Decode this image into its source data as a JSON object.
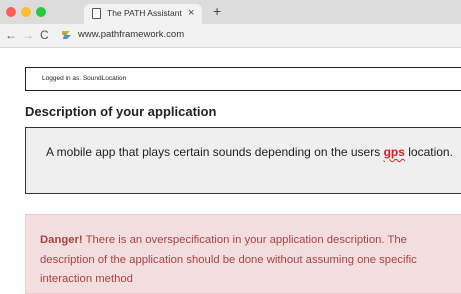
{
  "browser": {
    "tab_title": "The PATH Assistant",
    "tab_close": "×",
    "new_tab": "+",
    "back": "←",
    "forward": "→",
    "reload": "C",
    "url": "www.pathframework.com"
  },
  "page": {
    "login_status": "Logged in as: SoundLocation",
    "section_title": "Description of your application",
    "description": {
      "text_before": "A mobile app that plays certain sounds depending on the users ",
      "flagged_word": "gps",
      "text_after": " location."
    },
    "alert": {
      "label": "Danger!",
      "message": " There is an overspecification in your application description. The description of the application should be done without assuming one specific interaction method"
    }
  },
  "colors": {
    "alert_background": "#f2dede",
    "alert_text": "#a94442",
    "flagged_word": "#d82020"
  }
}
